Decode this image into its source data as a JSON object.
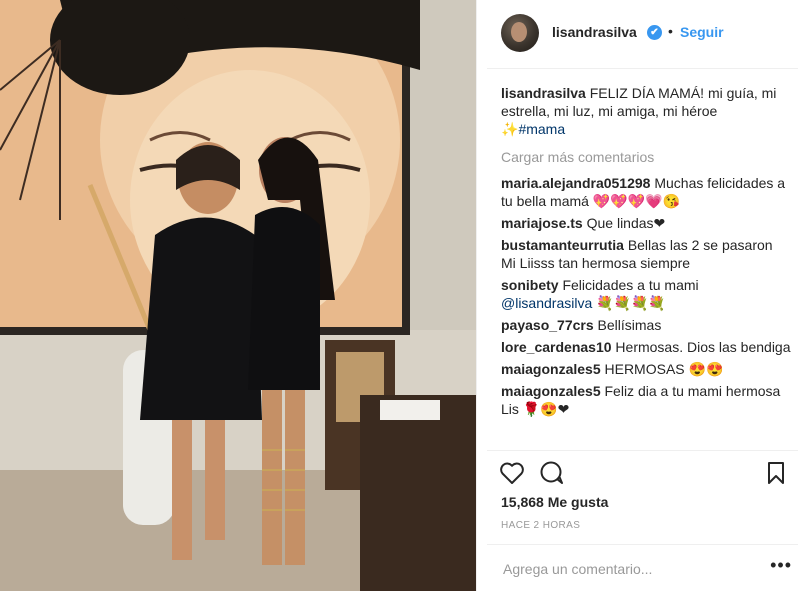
{
  "post": {
    "username": "lisandrasilva",
    "verified_mark": "✔",
    "separator": "•",
    "follow_label": "Seguir",
    "caption": {
      "user": "lisandrasilva",
      "text": "FELIZ DÍA MAMÁ! mi guía, mi estrella, mi luz, mi amiga, mi héroe",
      "emoji": "✨",
      "hashtag": "#mama"
    },
    "load_more": "Cargar más comentarios",
    "comments": [
      {
        "user": "maria.alejandra051298",
        "text": "Muchas felicidades a tu bella mamá 💖💖💖💗😘"
      },
      {
        "user": "mariajose.ts",
        "text": "Que lindas❤"
      },
      {
        "user": "bustamanteurrutia",
        "text": "Bellas las 2 se pasaron Mi Liisss tan hermosa siempre"
      },
      {
        "user": "sonibety",
        "text": "Felicidades a tu mami",
        "mention": "@lisandrasilva",
        "after": " 💐💐💐💐"
      },
      {
        "user": "payaso_77crs",
        "text": "Bellísimas"
      },
      {
        "user": "lore_cardenas10",
        "text": "Hermosas. Dios las bendiga"
      },
      {
        "user": "maiagonzales5",
        "text": "HERMOSAS 😍😍"
      },
      {
        "user": "maiagonzales5",
        "text": "Feliz dia a tu mami hermosa Lis 🌹😍❤"
      }
    ],
    "likes": "15,868 Me gusta",
    "time_ago": "HACE 2 HORAS",
    "comment_placeholder": "Agrega un comentario...",
    "more_label": "•••",
    "icons": [
      "heart-icon",
      "comment-icon",
      "bookmark-icon"
    ]
  }
}
